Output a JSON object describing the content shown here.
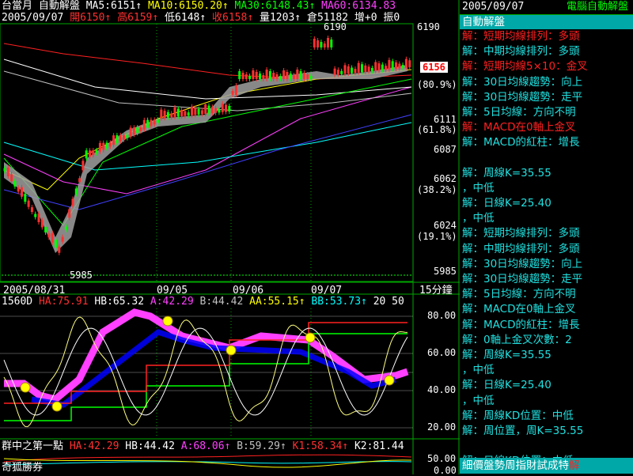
{
  "header1": {
    "stock_name": "台當月",
    "mode": "自動解盤",
    "ma5": "MA5:6151↑",
    "ma10": "MA10:6150.20↑",
    "ma30": "MA30:6148.43↑",
    "ma60": "MA60:6134.83"
  },
  "header2": {
    "date": "2005/09/07",
    "open": "開6150↑",
    "high": "高6159↑",
    "low": "低6148↑",
    "close": "收6158↑",
    "volume": "量1203↑",
    "oi": "倉51182",
    "change": "增+0",
    "amp": "振0"
  },
  "price_axis": {
    "ticks": [
      "6190",
      "6156",
      "(80.9%)",
      "6111",
      "(61.8%)",
      "6087",
      "6062",
      "(38.2%)",
      "6024",
      "(19.1%)",
      "5985"
    ],
    "current_price": "6156"
  },
  "price_annotations": {
    "high_label": "6190",
    "low_label": "5985"
  },
  "date_bar": {
    "labels": [
      "2005/08/31",
      "09/05",
      "09/06",
      "09/07"
    ],
    "period": "15分鐘"
  },
  "ind_header": {
    "code": "1560D",
    "ha": "HA:75.91",
    "hb": "HB:65.32",
    "a": "A:42.29",
    "b": "B:44.42",
    "aa": "AA:55.15↑",
    "bb": "BB:53.73↑",
    "p1": "20",
    "p2": "50"
  },
  "ind_axis": {
    "ticks": [
      "80.00",
      "60.00",
      "40.00",
      "20.00"
    ]
  },
  "bottom_header": {
    "title": "群中之第一點",
    "ha": "HA:42.29",
    "hb": "HB:44.42",
    "a": "A:68.06↑",
    "b": "B:59.29↑",
    "k1": "K1:58.34↑",
    "k2": "K2:81.44"
  },
  "bottom_axis": {
    "ticks": [
      "50.00",
      "0.00"
    ]
  },
  "bottom_label": "奇狐勝券",
  "sidebar": {
    "date": "2005/09/07",
    "title": "電腦自動解盤",
    "heading": "自動解盤",
    "lines": [
      {
        "text": "解：短期均線排列：多頭",
        "color": "#ff2020"
      },
      {
        "text": "解：中期均線排列：多頭",
        "color": "#20e0e0"
      },
      {
        "text": "解：短期均線5×10：金叉",
        "color": "#ff2020"
      },
      {
        "text": "解：30日均線趨勢：向上",
        "color": "#20e0e0"
      },
      {
        "text": "解：30日均線趨勢：走平",
        "color": "#20e0e0"
      },
      {
        "text": "解：5日均線：方向不明",
        "color": "#20e0e0"
      },
      {
        "text": "解：MACD在0軸上金叉",
        "color": "#ff2020"
      },
      {
        "text": "解：MACD的紅柱：增長",
        "color": "#20e0e0"
      },
      {
        "text": "",
        "color": "#20e0e0"
      },
      {
        "text": "解：周線K=35.55",
        "color": "#20e0e0"
      },
      {
        "text": "，中低",
        "color": "#20e0e0"
      },
      {
        "text": "解：日線K=25.40",
        "color": "#20e0e0"
      },
      {
        "text": "，中低",
        "color": "#20e0e0"
      },
      {
        "text": "解：短期均線排列：多頭",
        "color": "#20e0e0"
      },
      {
        "text": "解：中期均線排列：多頭",
        "color": "#20e0e0"
      },
      {
        "text": "解：30日均線趨勢：向上",
        "color": "#20e0e0"
      },
      {
        "text": "解：30日均線趨勢：走平",
        "color": "#20e0e0"
      },
      {
        "text": "解：5日均線：方向不明",
        "color": "#20e0e0"
      },
      {
        "text": "解：MACD在0軸上金叉",
        "color": "#20e0e0"
      },
      {
        "text": "解：MACD的紅柱：增長",
        "color": "#20e0e0"
      },
      {
        "text": "解：0軸上金叉次數：2",
        "color": "#20e0e0"
      },
      {
        "text": "解：周線K=35.55",
        "color": "#20e0e0"
      },
      {
        "text": "，中低",
        "color": "#20e0e0"
      },
      {
        "text": "解：日線K=25.40",
        "color": "#20e0e0"
      },
      {
        "text": "，中低",
        "color": "#20e0e0"
      },
      {
        "text": "解：周線KD位置：中低",
        "color": "#20e0e0"
      },
      {
        "text": "解：周位置，周K=35.55",
        "color": "#20e0e0"
      },
      {
        "text": "",
        "color": "#20e0e0"
      },
      {
        "text": "解：日線KD位置：中低",
        "color": "#20e0e0"
      }
    ],
    "footer": "細價盤勢周指財試成特",
    "footer_end": "解"
  }
}
